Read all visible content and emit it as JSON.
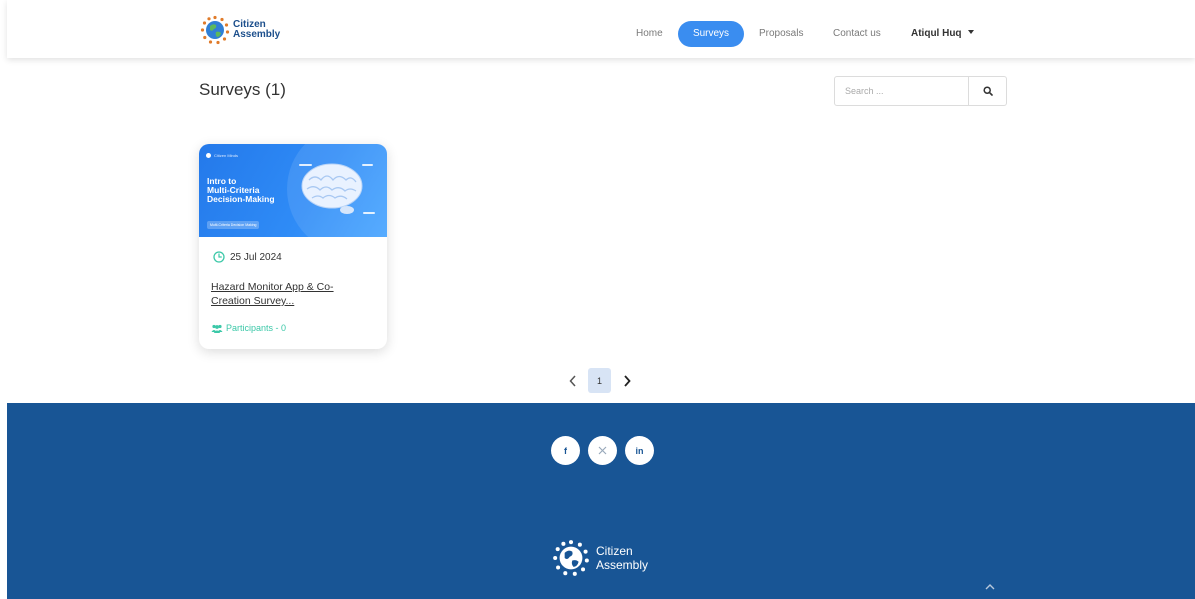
{
  "brand": {
    "line1": "Citizen",
    "line2": "Assembly"
  },
  "nav": {
    "items": [
      {
        "label": "Home",
        "active": false
      },
      {
        "label": "Surveys",
        "active": true
      },
      {
        "label": "Proposals",
        "active": false
      },
      {
        "label": "Contact us",
        "active": false
      }
    ],
    "user": "Atiqul Huq"
  },
  "page": {
    "title": "Surveys (1)"
  },
  "search": {
    "placeholder": "Search ...",
    "icon": "search-icon"
  },
  "card": {
    "image": {
      "brand": "Citizen Minds",
      "title": "Intro to\nMulti-Criteria\nDecision-Making",
      "tag": "Multi-Criteria Decision Making"
    },
    "date": "25 Jul 2024",
    "title": "Hazard Monitor App & Co-Creation Survey...",
    "participants": "Participants - 0"
  },
  "pagination": {
    "current": "1"
  },
  "footer": {
    "social": [
      {
        "name": "facebook",
        "glyph": "f"
      },
      {
        "name": "x",
        "glyph": "𝕏"
      },
      {
        "name": "linkedin",
        "glyph": "in"
      }
    ],
    "brand": {
      "line1": "Citizen",
      "line2": "Assembly"
    }
  },
  "colors": {
    "accent": "#3a8df0",
    "footer": "#185595",
    "participants": "#3cc8a8",
    "pager_active": "#d8e4f5"
  }
}
